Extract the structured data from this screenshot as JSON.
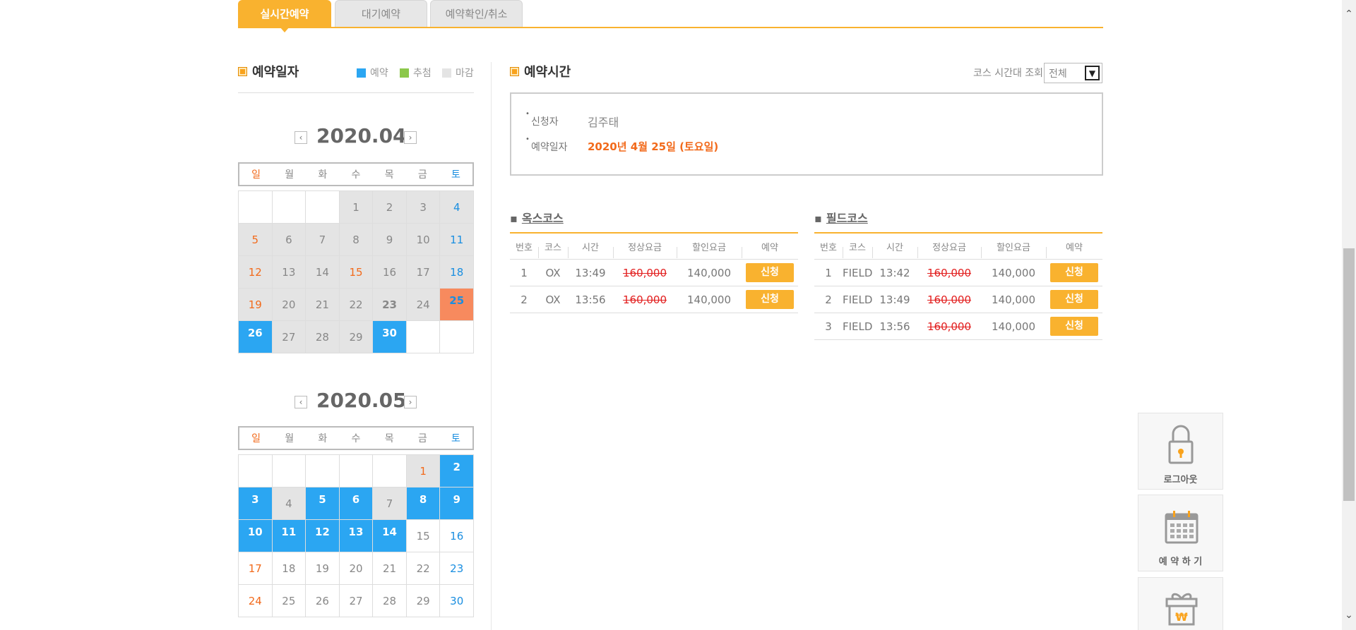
{
  "tabs": [
    {
      "label": "실시간예약",
      "active": true
    },
    {
      "label": "대기예약",
      "active": false
    },
    {
      "label": "예약확인/취소",
      "active": false
    }
  ],
  "left": {
    "title": "예약일자",
    "legend": [
      {
        "label": "예약",
        "color": "#2ba6f2"
      },
      {
        "label": "추첨",
        "color": "#8cc84b"
      },
      {
        "label": "마감",
        "color": "#e4e4e4"
      }
    ],
    "weekdays": [
      "일",
      "월",
      "화",
      "수",
      "목",
      "금",
      "토"
    ],
    "calendars": [
      {
        "month": "2020.04",
        "prev_icon": "‹",
        "next_icon": "›",
        "weeks": [
          [
            {
              "d": ""
            },
            {
              "d": ""
            },
            {
              "d": ""
            },
            {
              "d": "1",
              "s": "gray"
            },
            {
              "d": "2",
              "s": "gray"
            },
            {
              "d": "3",
              "s": "gray"
            },
            {
              "d": "4",
              "s": "gray"
            }
          ],
          [
            {
              "d": "5",
              "s": "gray"
            },
            {
              "d": "6",
              "s": "gray"
            },
            {
              "d": "7",
              "s": "gray"
            },
            {
              "d": "8",
              "s": "gray"
            },
            {
              "d": "9",
              "s": "gray"
            },
            {
              "d": "10",
              "s": "gray"
            },
            {
              "d": "11",
              "s": "gray"
            }
          ],
          [
            {
              "d": "12",
              "s": "gray"
            },
            {
              "d": "13",
              "s": "gray"
            },
            {
              "d": "14",
              "s": "gray"
            },
            {
              "d": "15",
              "s": "gray",
              "holiday": true
            },
            {
              "d": "16",
              "s": "gray"
            },
            {
              "d": "17",
              "s": "gray"
            },
            {
              "d": "18",
              "s": "gray"
            }
          ],
          [
            {
              "d": "19",
              "s": "gray"
            },
            {
              "d": "20",
              "s": "gray"
            },
            {
              "d": "21",
              "s": "gray"
            },
            {
              "d": "22",
              "s": "gray"
            },
            {
              "d": "23",
              "s": "gray",
              "bold": true
            },
            {
              "d": "24",
              "s": "gray"
            },
            {
              "d": "25",
              "s": "sel"
            }
          ],
          [
            {
              "d": "26",
              "s": "blue"
            },
            {
              "d": "27",
              "s": "gray"
            },
            {
              "d": "28",
              "s": "gray"
            },
            {
              "d": "29",
              "s": "gray"
            },
            {
              "d": "30",
              "s": "blue"
            },
            {
              "d": ""
            },
            {
              "d": ""
            }
          ]
        ]
      },
      {
        "month": "2020.05",
        "prev_icon": "‹",
        "next_icon": "›",
        "weeks": [
          [
            {
              "d": ""
            },
            {
              "d": ""
            },
            {
              "d": ""
            },
            {
              "d": ""
            },
            {
              "d": ""
            },
            {
              "d": "1",
              "s": "gray",
              "holiday": true
            },
            {
              "d": "2",
              "s": "blue"
            }
          ],
          [
            {
              "d": "3",
              "s": "blue"
            },
            {
              "d": "4",
              "s": "gray"
            },
            {
              "d": "5",
              "s": "blue"
            },
            {
              "d": "6",
              "s": "blue"
            },
            {
              "d": "7",
              "s": "gray"
            },
            {
              "d": "8",
              "s": "blue"
            },
            {
              "d": "9",
              "s": "blue"
            }
          ],
          [
            {
              "d": "10",
              "s": "blue"
            },
            {
              "d": "11",
              "s": "blue"
            },
            {
              "d": "12",
              "s": "blue"
            },
            {
              "d": "13",
              "s": "blue"
            },
            {
              "d": "14",
              "s": "blue"
            },
            {
              "d": "15"
            },
            {
              "d": "16"
            }
          ],
          [
            {
              "d": "17"
            },
            {
              "d": "18"
            },
            {
              "d": "19"
            },
            {
              "d": "20"
            },
            {
              "d": "21"
            },
            {
              "d": "22"
            },
            {
              "d": "23"
            }
          ],
          [
            {
              "d": "24"
            },
            {
              "d": "25"
            },
            {
              "d": "26"
            },
            {
              "d": "27"
            },
            {
              "d": "28"
            },
            {
              "d": "29"
            },
            {
              "d": "30"
            }
          ]
        ]
      }
    ]
  },
  "right": {
    "title": "예약시간",
    "filter_label": "코스 시간대 조회",
    "filter_value": "전체",
    "filter_arrow": "▼",
    "applicant_label": "신청자",
    "applicant_value": "김주태",
    "date_label": "예약일자",
    "date_value": "2020년 4월 25일 (토요일)",
    "table_headers": [
      "번호",
      "코스",
      "시간",
      "정상요금",
      "할인요금",
      "예약"
    ],
    "courses": [
      {
        "name": "옥스코스",
        "rows": [
          {
            "no": "1",
            "course": "OX",
            "time": "13:49",
            "normal": "160,000",
            "discount": "140,000",
            "action": "신청"
          },
          {
            "no": "2",
            "course": "OX",
            "time": "13:56",
            "normal": "160,000",
            "discount": "140,000",
            "action": "신청"
          }
        ]
      },
      {
        "name": "필드코스",
        "rows": [
          {
            "no": "1",
            "course": "FIELD",
            "time": "13:42",
            "normal": "160,000",
            "discount": "140,000",
            "action": "신청"
          },
          {
            "no": "2",
            "course": "FIELD",
            "time": "13:49",
            "normal": "160,000",
            "discount": "140,000",
            "action": "신청"
          },
          {
            "no": "3",
            "course": "FIELD",
            "time": "13:56",
            "normal": "160,000",
            "discount": "140,000",
            "action": "신청"
          }
        ]
      }
    ]
  },
  "quick_menu": [
    {
      "label": "로그아웃",
      "icon": "lock-icon"
    },
    {
      "label": "예 약 하 기",
      "icon": "calendar-icon"
    },
    {
      "label": "",
      "icon": "gift-icon",
      "symbol": "₩"
    }
  ],
  "scroll": {
    "up": "⌃",
    "down": "⌄"
  },
  "colors": {
    "accent": "#f9b22f",
    "reserve_blue": "#2ba6f2",
    "selected": "#f78a5e",
    "sunday": "#f26a1b",
    "saturday": "#1a8ee0"
  }
}
